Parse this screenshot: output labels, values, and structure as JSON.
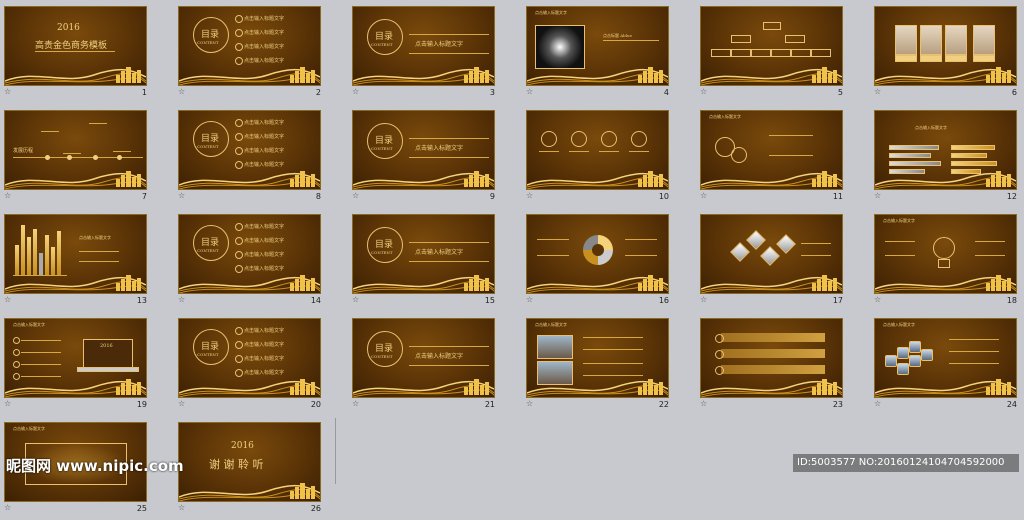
{
  "slides": [
    {
      "num": "1",
      "kind": "title",
      "year": "2016",
      "title": "高贵金色商务模板"
    },
    {
      "num": "2",
      "kind": "toc",
      "toc": "目录",
      "content": "CONTENT",
      "items": [
        "点击输入标题文字",
        "点击输入标题文字",
        "点击输入标题文字",
        "点击输入标题文字"
      ]
    },
    {
      "num": "3",
      "kind": "section",
      "toc": "目录",
      "content": "CONTENT",
      "heading": "点击输入标题文字"
    },
    {
      "num": "4",
      "kind": "photo",
      "heading": "点击输入标题文字",
      "sub": "点击标题 Ablue"
    },
    {
      "num": "5",
      "kind": "org"
    },
    {
      "num": "6",
      "kind": "people"
    },
    {
      "num": "7",
      "kind": "timeline",
      "label": "发展历程"
    },
    {
      "num": "8",
      "kind": "toc",
      "toc": "目录",
      "content": "CONTENT",
      "items": [
        "点击输入标题文字",
        "点击输入标题文字",
        "点击输入标题文字",
        "点击输入标题文字"
      ]
    },
    {
      "num": "9",
      "kind": "section",
      "toc": "目录",
      "content": "CONTENT",
      "heading": "点击输入标题文字"
    },
    {
      "num": "10",
      "kind": "circles"
    },
    {
      "num": "11",
      "kind": "gears",
      "heading": "点击输入标题文字"
    },
    {
      "num": "12",
      "kind": "hbars",
      "heading": "点击输入标题文字"
    },
    {
      "num": "13",
      "kind": "vbars",
      "heading": "点击输入标题文字"
    },
    {
      "num": "14",
      "kind": "toc",
      "toc": "目录",
      "content": "CONTENT",
      "items": [
        "点击输入标题文字",
        "点击输入标题文字",
        "点击输入标题文字",
        "点击输入标题文字"
      ]
    },
    {
      "num": "15",
      "kind": "section",
      "toc": "目录",
      "content": "CONTENT",
      "heading": "点击输入标题文字"
    },
    {
      "num": "16",
      "kind": "ring"
    },
    {
      "num": "17",
      "kind": "diamonds"
    },
    {
      "num": "18",
      "kind": "bulb",
      "heading": "点击输入标题文字"
    },
    {
      "num": "19",
      "kind": "laptop",
      "heading": "点击输入标题文字",
      "screen": "2016"
    },
    {
      "num": "20",
      "kind": "toc",
      "toc": "目录",
      "content": "CONTENT",
      "items": [
        "点击输入标题文字",
        "点击输入标题文字",
        "点击输入标题文字",
        "点击输入标题文字"
      ]
    },
    {
      "num": "21",
      "kind": "section",
      "toc": "目录",
      "content": "CONTENT",
      "heading": "点击输入标题文字"
    },
    {
      "num": "22",
      "kind": "photos2",
      "heading": "点击输入标题文字"
    },
    {
      "num": "23",
      "kind": "bars3"
    },
    {
      "num": "24",
      "kind": "hex",
      "heading": "点击输入标题文字"
    },
    {
      "num": "25",
      "kind": "map",
      "heading": "点击输入标题文字"
    },
    {
      "num": "26",
      "kind": "end",
      "year": "2016",
      "title": "谢 谢 聆 听"
    }
  ],
  "watermark": {
    "left": "昵图网 www.nipic.com",
    "right": "ID:5003577 NO:20160124104704592000"
  }
}
